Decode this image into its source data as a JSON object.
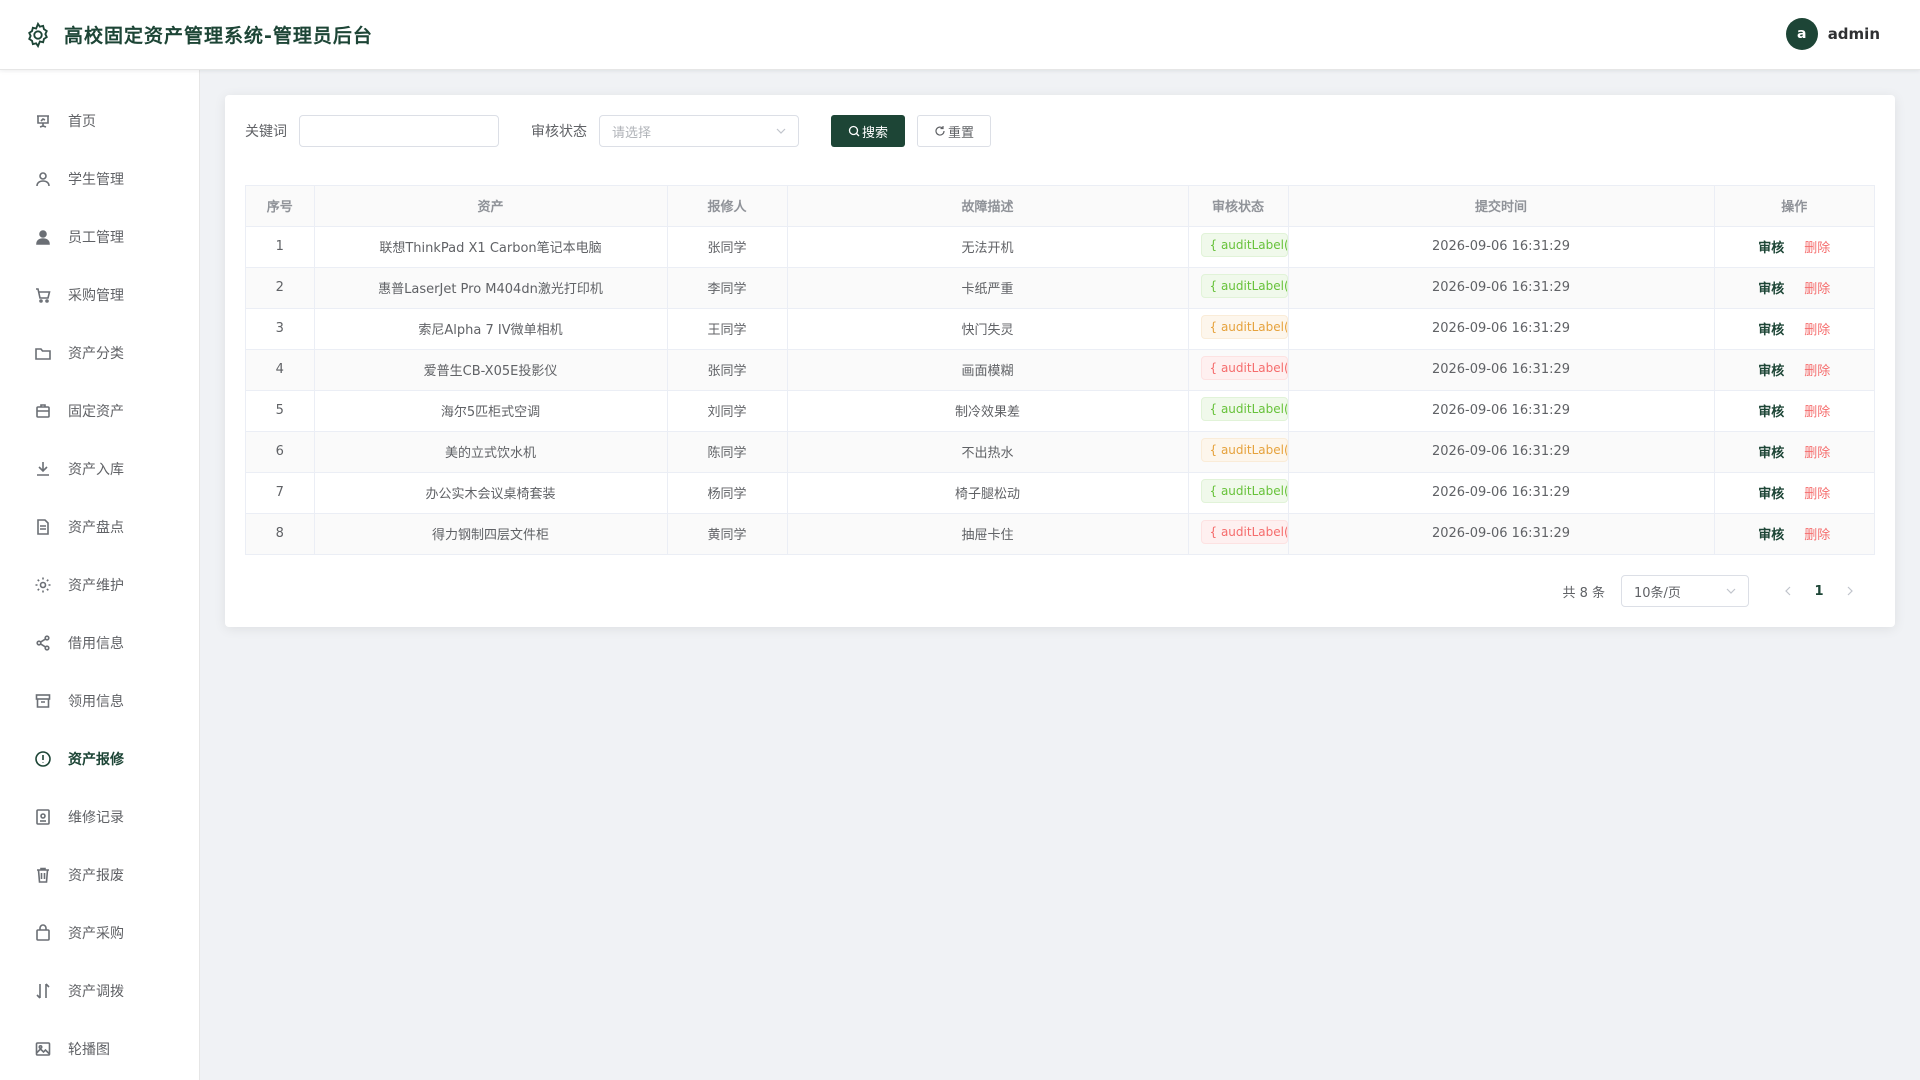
{
  "header": {
    "title": "高校固定资产管理系统-管理员后台",
    "avatar_letter": "a",
    "username": "admin"
  },
  "sidebar": {
    "items": [
      {
        "label": "首页",
        "icon": "presentation-icon",
        "active": false
      },
      {
        "label": "学生管理",
        "icon": "user-outline-icon",
        "active": false
      },
      {
        "label": "员工管理",
        "icon": "user-filled-icon",
        "active": false
      },
      {
        "label": "采购管理",
        "icon": "cart-icon",
        "active": false
      },
      {
        "label": "资产分类",
        "icon": "folder-icon",
        "active": false
      },
      {
        "label": "固定资产",
        "icon": "briefcase-icon",
        "active": false
      },
      {
        "label": "资产入库",
        "icon": "download-icon",
        "active": false
      },
      {
        "label": "资产盘点",
        "icon": "document-icon",
        "active": false
      },
      {
        "label": "资产维护",
        "icon": "gear-icon",
        "active": false
      },
      {
        "label": "借用信息",
        "icon": "share-icon",
        "active": false
      },
      {
        "label": "领用信息",
        "icon": "box-icon",
        "active": false
      },
      {
        "label": "资产报修",
        "icon": "warning-circle-icon",
        "active": true
      },
      {
        "label": "维修记录",
        "icon": "record-icon",
        "active": false
      },
      {
        "label": "资产报废",
        "icon": "trash-icon",
        "active": false
      },
      {
        "label": "资产采购",
        "icon": "bag-icon",
        "active": false
      },
      {
        "label": "资产调拨",
        "icon": "transfer-icon",
        "active": false
      },
      {
        "label": "轮播图",
        "icon": "picture-icon",
        "active": false
      }
    ]
  },
  "search": {
    "keyword_label": "关键词",
    "keyword_value": "",
    "status_label": "审核状态",
    "status_placeholder": "请选择",
    "search_button": "搜索",
    "reset_button": "重置"
  },
  "table": {
    "columns": [
      "序号",
      "资产",
      "报修人",
      "故障描述",
      "审核状态",
      "提交时间",
      "操作"
    ],
    "rows": [
      {
        "no": "1",
        "asset": "联想ThinkPad X1 Carbon笔记本电脑",
        "reporter": "张同学",
        "fault": "无法开机",
        "status": "{ auditLabel(row",
        "status_color": "green",
        "time": "2026-09-06 16:31:29"
      },
      {
        "no": "2",
        "asset": "惠普LaserJet Pro M404dn激光打印机",
        "reporter": "李同学",
        "fault": "卡纸严重",
        "status": "{ auditLabel(row",
        "status_color": "green",
        "time": "2026-09-06 16:31:29"
      },
      {
        "no": "3",
        "asset": "索尼Alpha 7 IV微单相机",
        "reporter": "王同学",
        "fault": "快门失灵",
        "status": "{ auditLabel(row",
        "status_color": "orange",
        "time": "2026-09-06 16:31:29"
      },
      {
        "no": "4",
        "asset": "爱普生CB-X05E投影仪",
        "reporter": "张同学",
        "fault": "画面模糊",
        "status": "{ auditLabel(row",
        "status_color": "red",
        "time": "2026-09-06 16:31:29"
      },
      {
        "no": "5",
        "asset": "海尔5匹柜式空调",
        "reporter": "刘同学",
        "fault": "制冷效果差",
        "status": "{ auditLabel(row",
        "status_color": "green",
        "time": "2026-09-06 16:31:29"
      },
      {
        "no": "6",
        "asset": "美的立式饮水机",
        "reporter": "陈同学",
        "fault": "不出热水",
        "status": "{ auditLabel(row",
        "status_color": "orange",
        "time": "2026-09-06 16:31:29"
      },
      {
        "no": "7",
        "asset": "办公实木会议桌椅套装",
        "reporter": "杨同学",
        "fault": "椅子腿松动",
        "status": "{ auditLabel(row",
        "status_color": "green",
        "time": "2026-09-06 16:31:29"
      },
      {
        "no": "8",
        "asset": "得力钢制四层文件柜",
        "reporter": "黄同学",
        "fault": "抽屉卡住",
        "status": "{ auditLabel(row",
        "status_color": "red",
        "time": "2026-09-06 16:31:29"
      }
    ],
    "audit_label": "审核",
    "delete_label": "删除"
  },
  "pagination": {
    "total_text": "共 8 条",
    "page_size": "10条/页",
    "current_page": "1"
  },
  "colors": {
    "brand": "#1d4536",
    "danger": "#f56c6c",
    "success": "#67c23a",
    "warning": "#e6a23c"
  }
}
